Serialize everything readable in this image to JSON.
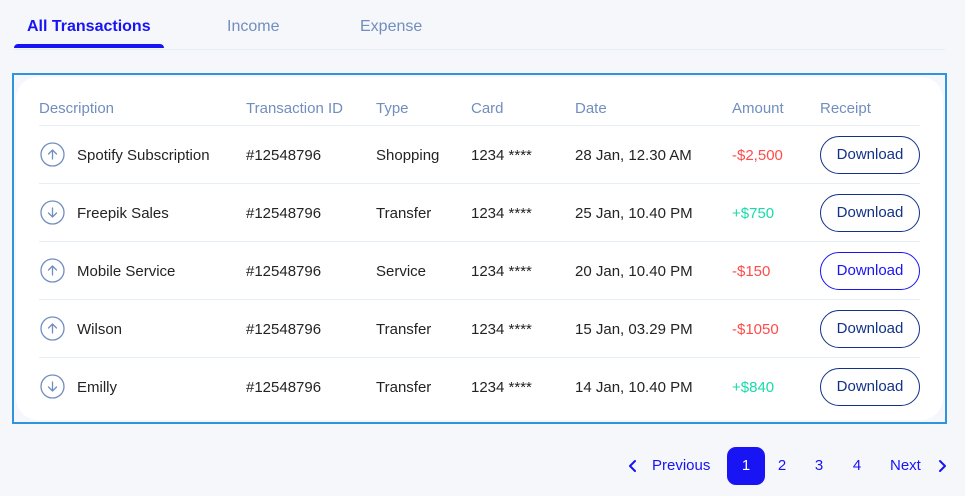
{
  "tabs": [
    {
      "label": "All Transactions",
      "active": true
    },
    {
      "label": "Income",
      "active": false
    },
    {
      "label": "Expense",
      "active": false
    }
  ],
  "table": {
    "headers": [
      "Description",
      "Transaction ID",
      "Type",
      "Card",
      "Date",
      "Amount",
      "Receipt"
    ],
    "rows": [
      {
        "direction": "up-arrow-icon",
        "description": "Spotify Subscription",
        "transaction_id": "#12548796",
        "type": "Shopping",
        "card": "1234 ****",
        "date": "28 Jan, 12.30 AM",
        "amount": "-$2,500",
        "amount_sign": "negative",
        "receipt": "Download"
      },
      {
        "direction": "down-arrow-icon",
        "description": "Freepik Sales",
        "transaction_id": "#12548796",
        "type": "Transfer",
        "card": "1234 ****",
        "date": "25 Jan, 10.40 PM",
        "amount": "+$750",
        "amount_sign": "positive",
        "receipt": "Download"
      },
      {
        "direction": "up-arrow-icon",
        "description": "Mobile Service",
        "transaction_id": "#12548796",
        "type": "Service",
        "card": "1234 ****",
        "date": "20 Jan, 10.40 PM",
        "amount": "-$150",
        "amount_sign": "negative",
        "receipt": "Download"
      },
      {
        "direction": "up-arrow-icon",
        "description": "Wilson",
        "transaction_id": "#12548796",
        "type": "Transfer",
        "card": "1234 ****",
        "date": "15 Jan, 03.29 PM",
        "amount": "-$1050",
        "amount_sign": "negative",
        "receipt": "Download"
      },
      {
        "direction": "down-arrow-icon",
        "description": "Emilly",
        "transaction_id": "#12548796",
        "type": "Transfer",
        "card": "1234 ****",
        "date": "14 Jan, 10.40 PM",
        "amount": "+$840",
        "amount_sign": "positive",
        "receipt": "Download"
      }
    ]
  },
  "pagination": {
    "previous_label": "Previous",
    "next_label": "Next",
    "pages": [
      "1",
      "2",
      "3",
      "4"
    ],
    "current_page": "1"
  },
  "colors": {
    "accent": "#1814f3",
    "muted": "#718ebf",
    "negative": "#ff4b4a",
    "positive": "#16dbaa",
    "button_border": "#123288"
  }
}
